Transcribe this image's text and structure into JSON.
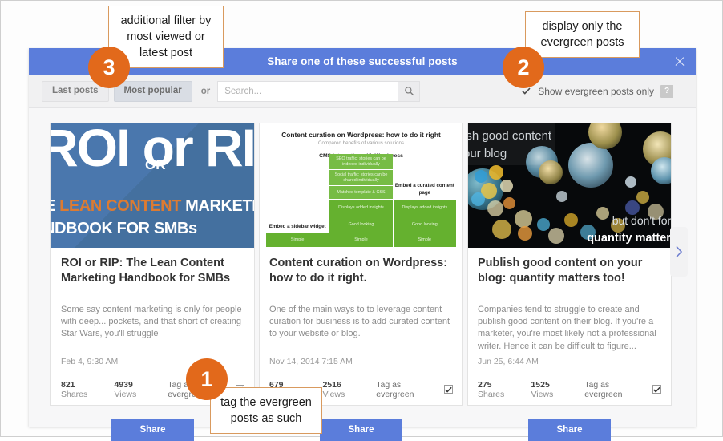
{
  "modal": {
    "title": "Share one of these successful posts",
    "close_icon": "close-icon"
  },
  "toolbar": {
    "last_posts_label": "Last posts",
    "most_popular_label": "Most popular",
    "or_label": "or",
    "search_placeholder": "Search...",
    "search_value": "",
    "search_icon": "search-icon",
    "evergreen_filter_label": "Show evergreen posts only",
    "evergreen_filter_checked": true,
    "help_label": "?"
  },
  "colors": {
    "accent_blue": "#5b7ddb",
    "badge_orange": "#e2691b",
    "annotation_border": "#d99a5e",
    "card1_blue": "#4a77ad",
    "card2_green": "#65b12f"
  },
  "cards": [
    {
      "title": "ROI or RIP: The Lean Content Marketing Handbook for SMBs",
      "excerpt": "Some say content marketing is only for people with deep... pockets, and that short of creating Star Wars, you'll struggle",
      "date": "Feb 4, 9:30 AM",
      "shares": "821",
      "shares_label": "Shares",
      "views": "4939",
      "views_label": "Views",
      "tag_label": "Tag as evergreen",
      "tagged": true,
      "share_button": "Share",
      "image": {
        "kind": "cover-roi-or-rip",
        "headline": "ROI or RIP",
        "or_word": "OR",
        "sub_line_1_pre": "E ",
        "sub_line_1_highlight": "LEAN CONTENT",
        "sub_line_1_post": " MARKETIN",
        "sub_line_2": "NDBOOK FOR SMBs"
      }
    },
    {
      "title": "Content curation on Wordpress: how to do it right.",
      "excerpt": "One of the main ways to to leverage content curation for business is to add curated content to your website or blog.",
      "date": "Nov 14, 2014 7:15 AM",
      "shares": "679",
      "shares_label": "Shares",
      "views": "2516",
      "views_label": "Views",
      "tag_label": "Tag as evergreen",
      "tagged": true,
      "share_button": "Share",
      "image": {
        "kind": "chart-content-curation",
        "chart_title": "Content curation on Wordpress: how to do it right",
        "chart_subtitle": "Compared benefits of various solutions",
        "col_center_header": "CMS integration with Wordpress",
        "col_left_label": "Embed a sidebar widget",
        "col_right_label": "Embed a curated content page",
        "center_blocks": [
          "SEO traffic: stories can be indexed individually",
          "Social traffic: stories can be shared individually",
          "Matches template & CSS",
          "Displays added insights",
          "Good looking",
          "Simple"
        ],
        "right_blocks": [
          "Displays added insights",
          "Good looking",
          "Simple"
        ],
        "left_blocks": [
          "Simple"
        ]
      }
    },
    {
      "title": "Publish good content on your blog: quantity matters too!",
      "excerpt": "Companies tend to struggle to create and publish good content on their blog. If you're a marketer, you're most likely not a professional writer. Hence it can be difficult to figure...",
      "date": "Jun 25, 6:44 AM",
      "shares": "275",
      "shares_label": "Shares",
      "views": "1525",
      "views_label": "Views",
      "tag_label": "Tag as evergreen",
      "tagged": true,
      "share_button": "Share",
      "image": {
        "kind": "photo-bokeh-bubbles",
        "overlay_top": "ish good content\nour blog",
        "overlay_bottom_1": "but don't forg",
        "overlay_bottom_2": "quantity matters"
      }
    }
  ],
  "carousel": {
    "next_icon": "chevron-right-icon"
  },
  "annotations": [
    {
      "number": "1",
      "text": "tag the evergreen posts as such"
    },
    {
      "number": "2",
      "text": "display only the evergreen posts"
    },
    {
      "number": "3",
      "text": "additional filter by most viewed or latest post"
    }
  ]
}
